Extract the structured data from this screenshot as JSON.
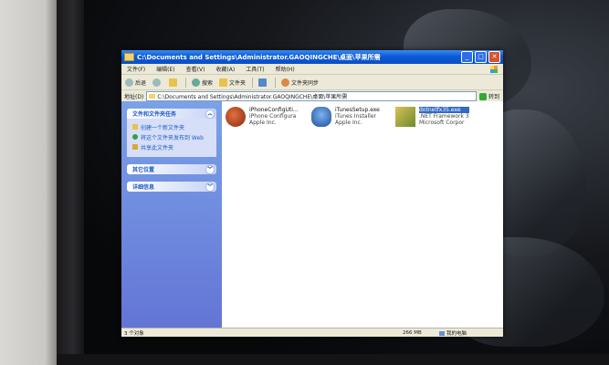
{
  "window": {
    "title": "C:\\Documents and Settings\\Administrator.GAOQINGCHE\\桌面\\苹果所需"
  },
  "menu": [
    "文件(F)",
    "编辑(E)",
    "查看(V)",
    "收藏(A)",
    "工具(T)",
    "帮助(H)"
  ],
  "toolbar": {
    "back": "后退",
    "search": "搜索",
    "folders": "文件夹",
    "sync": "文件夹同步"
  },
  "address": {
    "label": "地址(D)",
    "value": "C:\\Documents and Settings\\Administrator.GAOQINGCHE\\桌面\\苹果所需",
    "go": "转到"
  },
  "taskpane": {
    "file_tasks": {
      "title": "文件和文件夹任务",
      "links": [
        "创建一个新文件夹",
        "将这个文件夹发布到 Web",
        "共享此文件夹"
      ]
    },
    "other_places": "其它位置",
    "details": "详细信息"
  },
  "files": [
    {
      "name": "iPhoneConfigUti...",
      "desc": "iPhone Configura",
      "company": "Apple Inc."
    },
    {
      "name": "iTunesSetup.exe",
      "desc": "iTunes Installer",
      "company": "Apple Inc."
    },
    {
      "name": "dotnetfx35.exe",
      "desc": ".NET Framework 3",
      "company": "Microsoft Corpor"
    }
  ],
  "status": {
    "objects": "3 个对象",
    "size": "266 MB",
    "location": "我的电脑"
  }
}
